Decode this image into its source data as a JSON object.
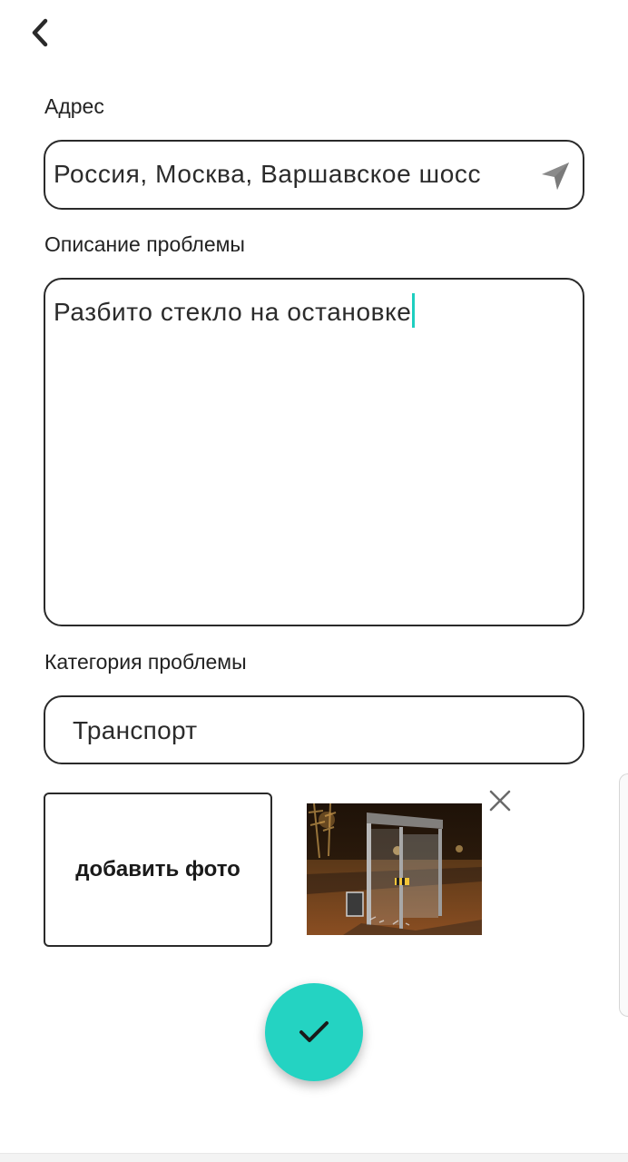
{
  "header": {
    "back_icon": "chevron-left-icon"
  },
  "address": {
    "label": "Адрес",
    "value": "Россия, Москва, Варшавское шосс",
    "locate_icon": "navigation-arrow-icon"
  },
  "description": {
    "label": "Описание проблемы",
    "value": "Разбито стекло на остановке",
    "caret_color": "#1ecfc0"
  },
  "category": {
    "label": "Категория проблемы",
    "value": "Транспорт"
  },
  "photos": {
    "add_label": "добавить фото",
    "remove_icon": "close-icon",
    "thumbnail_subject": "broken glass bus stop at night"
  },
  "submit": {
    "icon": "checkmark-icon",
    "color": "#24d3c2"
  }
}
